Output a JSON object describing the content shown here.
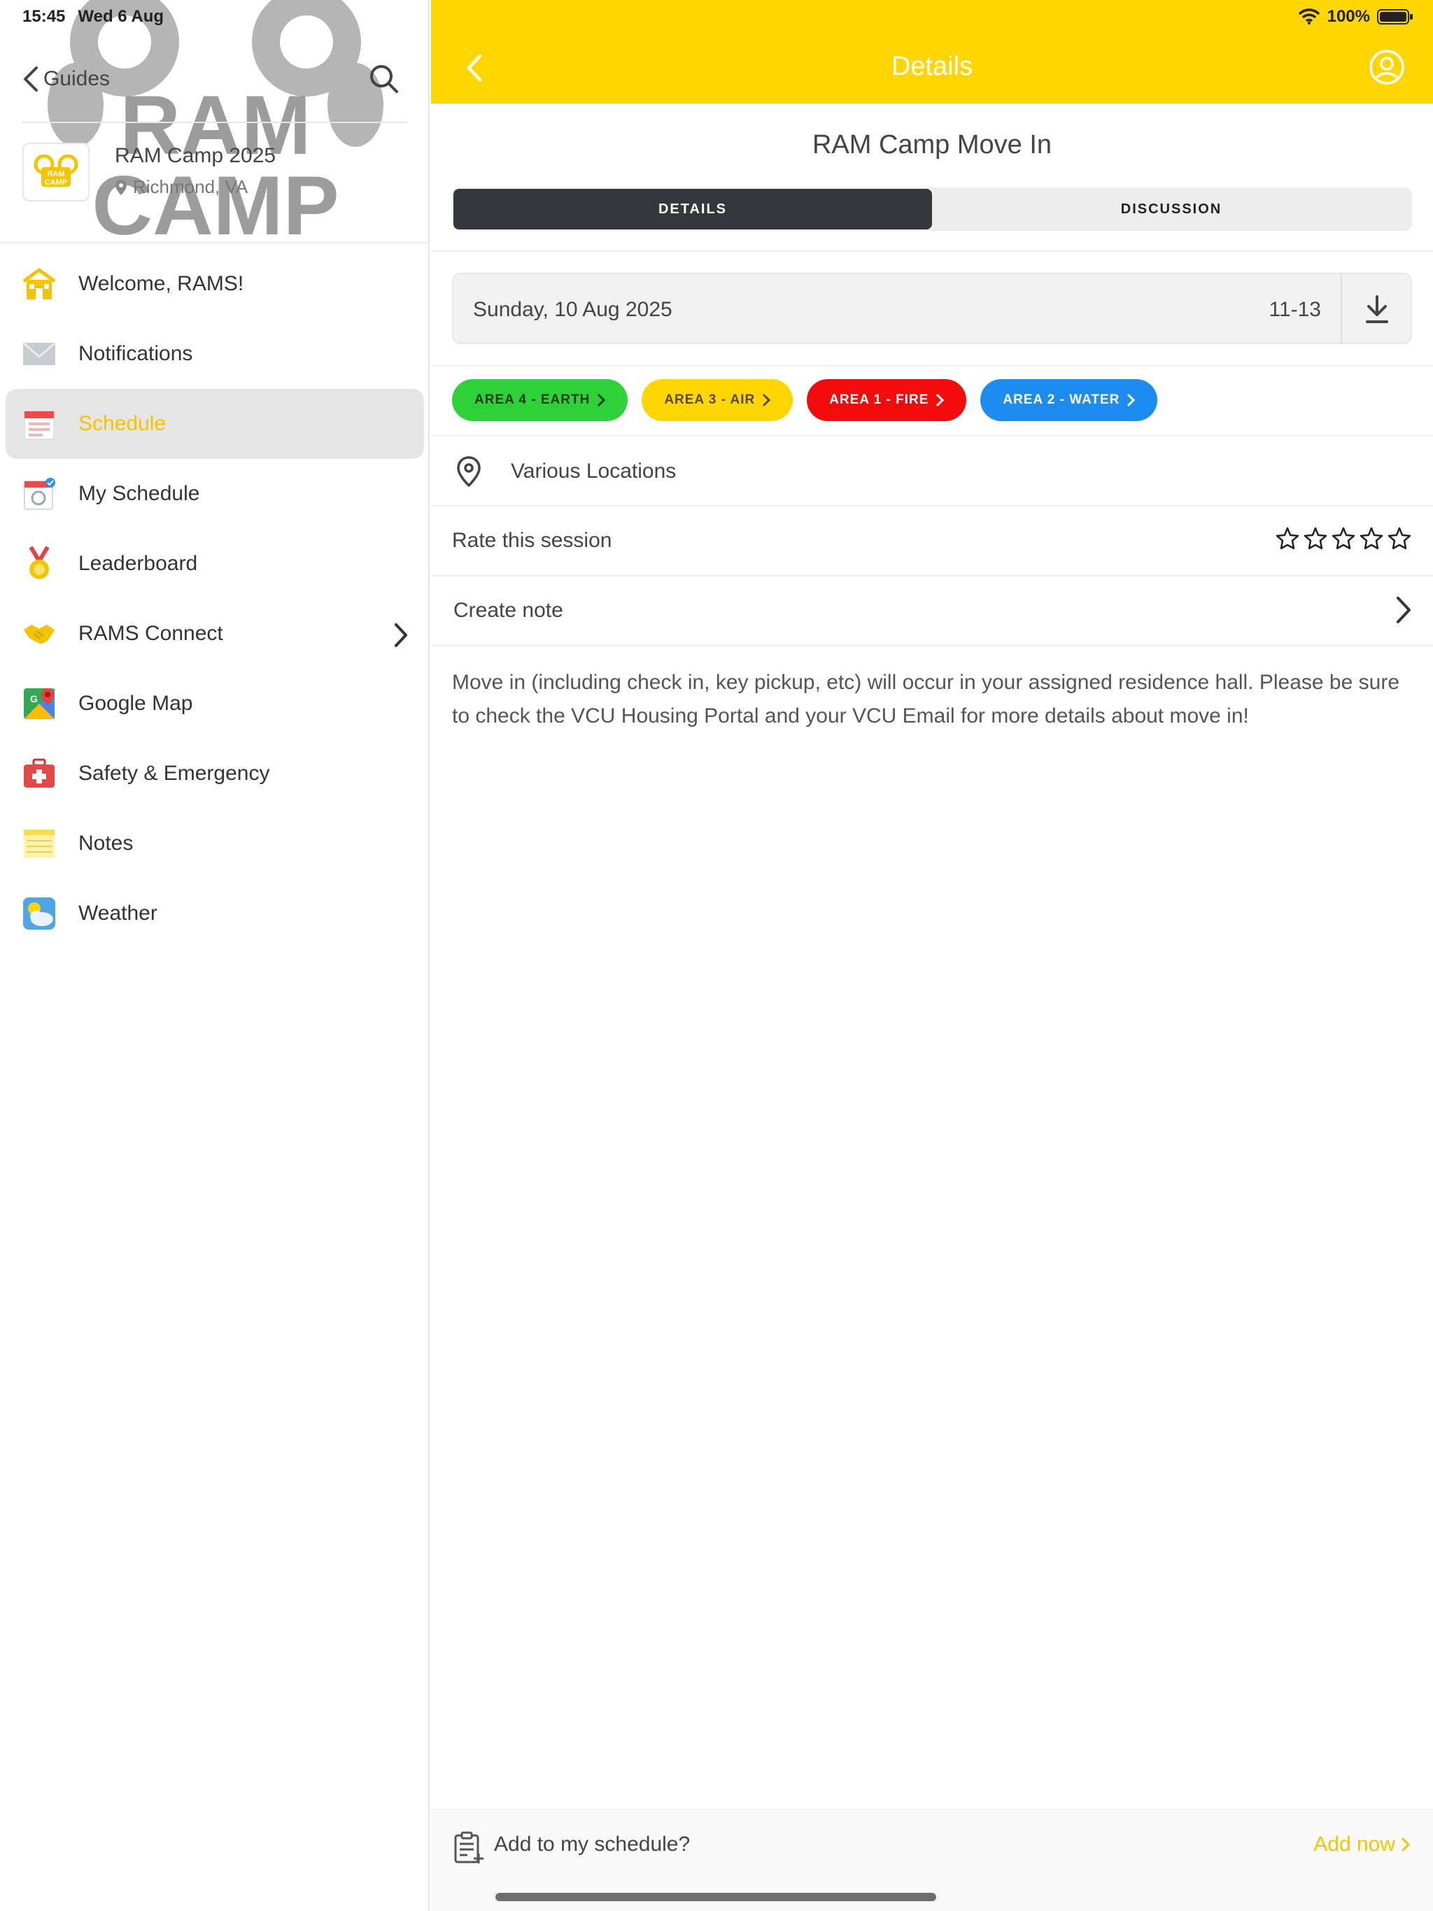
{
  "status": {
    "time": "15:45",
    "date": "Wed 6 Aug",
    "battery": "100%"
  },
  "sidebar": {
    "back_label": "Guides",
    "guide": {
      "name": "RAM Camp 2025",
      "location": "Richmond, VA",
      "logo_text": "RAM CAMP",
      "watermark_top": "RAM",
      "watermark_bottom": "CAMP"
    },
    "items": [
      {
        "label": "Welcome, RAMS!",
        "icon": "house-icon"
      },
      {
        "label": "Notifications",
        "icon": "envelope-icon"
      },
      {
        "label": "Schedule",
        "icon": "calendar-icon",
        "active": true
      },
      {
        "label": "My Schedule",
        "icon": "my-schedule-icon"
      },
      {
        "label": "Leaderboard",
        "icon": "medal-icon"
      },
      {
        "label": "RAMS Connect",
        "icon": "handshake-icon",
        "has_chevron": true
      },
      {
        "label": "Google Map",
        "icon": "google-map-icon"
      },
      {
        "label": "Safety & Emergency",
        "icon": "first-aid-icon"
      },
      {
        "label": "Notes",
        "icon": "notepad-icon"
      },
      {
        "label": "Weather",
        "icon": "weather-icon"
      }
    ]
  },
  "header": {
    "title": "Details"
  },
  "session": {
    "title": "RAM Camp Move In",
    "tabs": [
      {
        "label": "DETAILS",
        "active": true
      },
      {
        "label": "DISCUSSION",
        "active": false
      }
    ],
    "date": "Sunday, 10 Aug 2025",
    "time": "11-13",
    "tags": [
      {
        "label": "AREA 4 - EARTH",
        "bg": "#2ed13a",
        "fg": "#1a3d12"
      },
      {
        "label": "AREA 3 - AIR",
        "bg": "#ffd600",
        "fg": "#5a4a00"
      },
      {
        "label": "AREA 1 - FIRE",
        "bg": "#f40c0c",
        "fg": "#ffffff"
      },
      {
        "label": "AREA 2 - WATER",
        "bg": "#1c8cf0",
        "fg": "#ffffff"
      }
    ],
    "location": "Various Locations",
    "rate_label": "Rate this session",
    "rating": 0,
    "rating_max": 5,
    "note_label": "Create note",
    "description": "Move in (including check in, key pickup, etc) will occur in your assigned residence hall. Please be sure to check the VCU Housing Portal and your VCU Email for more details about move in!"
  },
  "bottom": {
    "label": "Add to my schedule?",
    "action": "Add now"
  },
  "colors": {
    "accent": "#ffd600",
    "active_text": "#f5c400",
    "tab_active": "#34383d"
  }
}
